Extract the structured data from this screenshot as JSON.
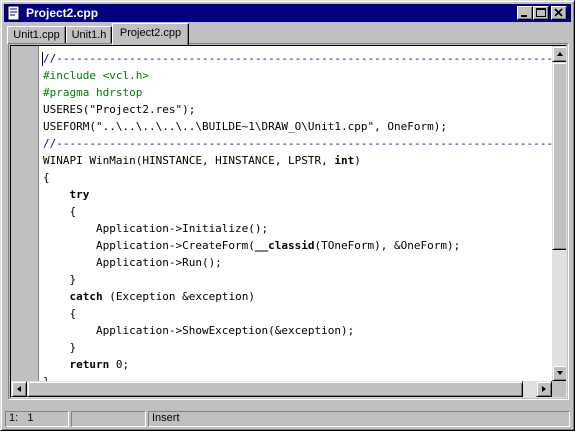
{
  "window": {
    "title": "Project2.cpp",
    "icon": "document-icon",
    "buttons": [
      "minimize-icon",
      "maximize-icon",
      "close-icon"
    ]
  },
  "tabs": [
    {
      "label": "Unit1.cpp",
      "active": false
    },
    {
      "label": "Unit1.h",
      "active": false
    },
    {
      "label": "Project2.cpp",
      "active": true
    }
  ],
  "code": {
    "lines": [
      {
        "kind": "comment",
        "text": "//---------------------------------------------------------------------------"
      },
      {
        "kind": "dir",
        "text": "#include <vcl.h>"
      },
      {
        "kind": "dir",
        "text": "#pragma hdrstop"
      },
      {
        "kind": "plain",
        "text": "USERES(\"Project2.res\");"
      },
      {
        "kind": "plain",
        "text": "USEFORM(\"..\\..\\..\\..\\..\\BUILDE~1\\DRAW_O\\Unit1.cpp\", OneForm);"
      },
      {
        "kind": "comment",
        "text": "//---------------------------------------------------------------------------"
      },
      {
        "kind": "plain",
        "pre": "WINAPI WinMain(HINSTANCE, HINSTANCE, LPSTR, ",
        "kw": "int",
        "post": ")"
      },
      {
        "kind": "plain",
        "text": "{"
      },
      {
        "kind": "plain",
        "pre": "    ",
        "kw": "try",
        "post": ""
      },
      {
        "kind": "plain",
        "text": "    {"
      },
      {
        "kind": "plain",
        "text": "        Application->Initialize();"
      },
      {
        "kind": "plain",
        "pre": "        Application->CreateForm(",
        "kw": "__classid",
        "post": "(TOneForm), &OneForm);"
      },
      {
        "kind": "plain",
        "text": "        Application->Run();"
      },
      {
        "kind": "plain",
        "text": "    }"
      },
      {
        "kind": "plain",
        "pre": "    ",
        "kw": "catch",
        "post": " (Exception &exception)"
      },
      {
        "kind": "plain",
        "text": "    {"
      },
      {
        "kind": "plain",
        "text": "        Application->ShowException(&exception);"
      },
      {
        "kind": "plain",
        "text": "    }"
      },
      {
        "kind": "plain",
        "pre": "    ",
        "kw": "return",
        "post": " 0;"
      },
      {
        "kind": "plain",
        "text": "}"
      }
    ]
  },
  "status": {
    "position": "1:   1",
    "modified": "",
    "mode": "Insert"
  }
}
